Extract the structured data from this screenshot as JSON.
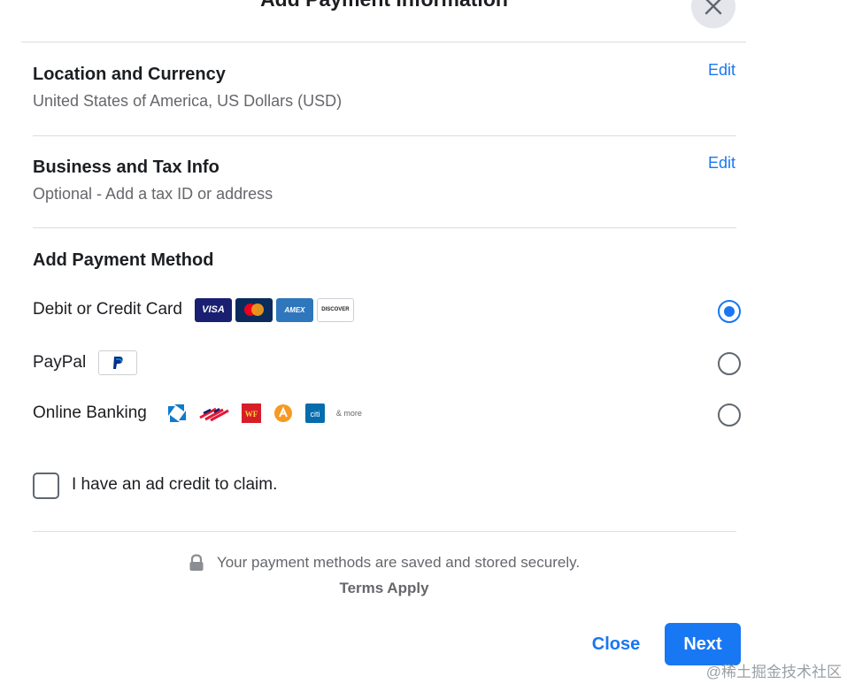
{
  "dialog": {
    "title": "Add Payment Information"
  },
  "location": {
    "title": "Location and Currency",
    "subtitle": "United States of America, US Dollars (USD)",
    "edit": "Edit"
  },
  "business": {
    "title": "Business and Tax Info",
    "subtitle": "Optional - Add a tax ID or address",
    "edit": "Edit"
  },
  "payment": {
    "title": "Add Payment Method",
    "selected": "card",
    "card": {
      "label": "Debit or Credit Card",
      "logos": {
        "visa": "VISA",
        "amex": "AMEX",
        "discover": "DISCOVER"
      }
    },
    "paypal": {
      "label": "PayPal"
    },
    "banking": {
      "label": "Online Banking",
      "citi": "citi",
      "more": "& more"
    }
  },
  "ad_credit": {
    "label": "I have an ad credit to claim.",
    "checked": false
  },
  "secure": {
    "text": "Your payment methods are saved and stored securely.",
    "terms": "Terms Apply"
  },
  "footer": {
    "close": "Close",
    "next": "Next"
  },
  "watermark": "@稀土掘金技术社区",
  "colors": {
    "accent": "#1877f2",
    "divider": "#dadde1",
    "muted": "#65676b"
  }
}
